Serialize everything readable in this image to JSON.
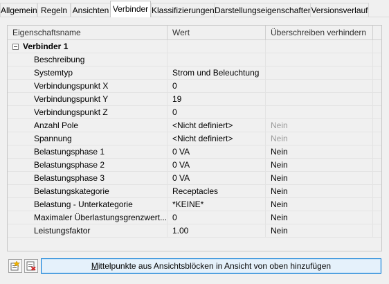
{
  "tabs": [
    {
      "label": "Allgemein",
      "active": false
    },
    {
      "label": "Regeln",
      "active": false
    },
    {
      "label": "Ansichten",
      "active": false
    },
    {
      "label": "Verbinder",
      "active": true
    },
    {
      "label": "Klassifizierungen",
      "active": false
    },
    {
      "label": "Darstellungseigenschaften",
      "active": false
    },
    {
      "label": "Versionsverlauf",
      "active": false
    }
  ],
  "grid": {
    "headers": {
      "name": "Eigenschaftsname",
      "value": "Wert",
      "override": "Überschreiben verhindern"
    },
    "group": {
      "label": "Verbinder 1",
      "expanded": true
    },
    "rows": [
      {
        "name": "Beschreibung",
        "value": "",
        "override": "",
        "override_enabled": true
      },
      {
        "name": "Systemtyp",
        "value": "Strom und Beleuchtung",
        "override": "",
        "override_enabled": true
      },
      {
        "name": "Verbindungspunkt X",
        "value": "0",
        "override": "",
        "override_enabled": true
      },
      {
        "name": "Verbindungspunkt Y",
        "value": "19",
        "override": "",
        "override_enabled": true
      },
      {
        "name": "Verbindungspunkt Z",
        "value": "0",
        "override": "",
        "override_enabled": true
      },
      {
        "name": "Anzahl Pole",
        "value": "<Nicht definiert>",
        "override": "Nein",
        "override_enabled": false
      },
      {
        "name": "Spannung",
        "value": "<Nicht definiert>",
        "override": "Nein",
        "override_enabled": false
      },
      {
        "name": "Belastungsphase 1",
        "value": "0 VA",
        "override": "Nein",
        "override_enabled": true
      },
      {
        "name": "Belastungsphase 2",
        "value": "0 VA",
        "override": "Nein",
        "override_enabled": true
      },
      {
        "name": "Belastungsphase 3",
        "value": "0 VA",
        "override": "Nein",
        "override_enabled": true
      },
      {
        "name": "Belastungskategorie",
        "value": "Receptacles",
        "override": "Nein",
        "override_enabled": true
      },
      {
        "name": "Belastung - Unterkategorie",
        "value": "*KEINE*",
        "override": "Nein",
        "override_enabled": true
      },
      {
        "name": "Maximaler Überlastungsgrenzwert...",
        "value": "0",
        "override": "Nein",
        "override_enabled": true
      },
      {
        "name": "Leistungsfaktor",
        "value": "1.00",
        "override": "Nein",
        "override_enabled": true
      }
    ]
  },
  "bottom": {
    "add_icon": "add-connector-icon",
    "remove_icon": "remove-connector-icon",
    "button_label_first": "M",
    "button_label_rest": "ittelpunkte aus Ansichtsblöcken in Ansicht von oben hinzufügen"
  }
}
